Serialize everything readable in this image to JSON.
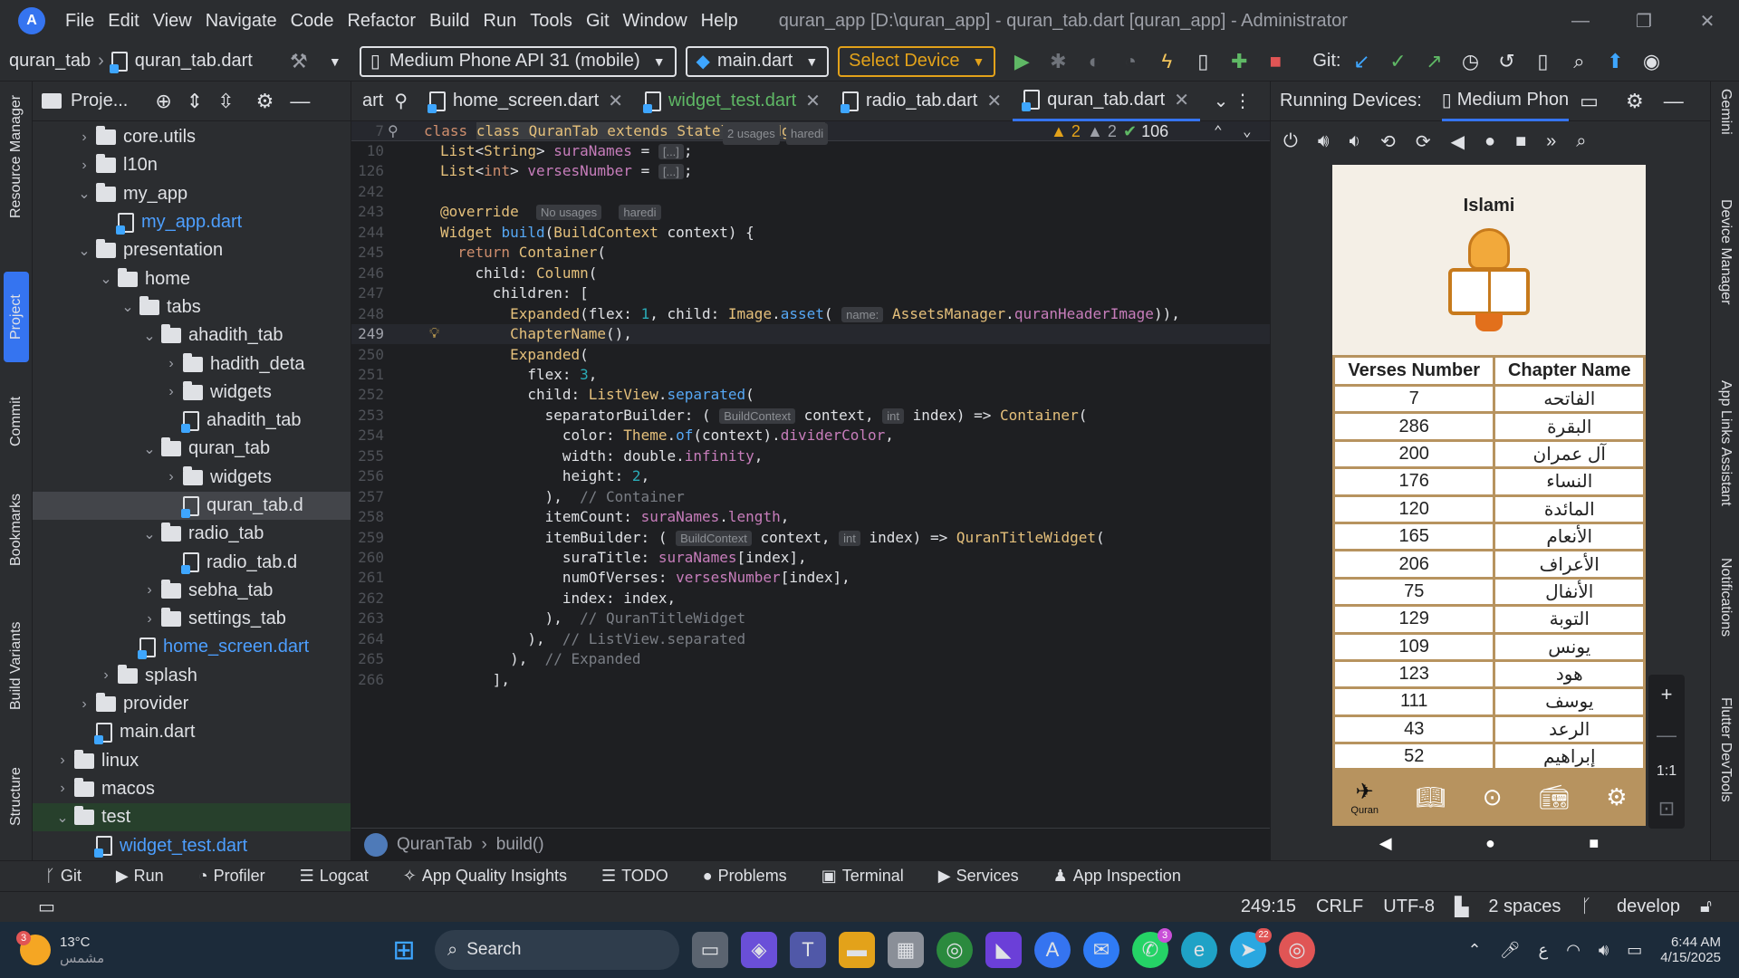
{
  "menubar": {
    "items": [
      "File",
      "Edit",
      "View",
      "Navigate",
      "Code",
      "Refactor",
      "Build",
      "Run",
      "Tools",
      "Git",
      "Window",
      "Help"
    ],
    "window_title": "quran_app [D:\\quran_app] - quran_tab.dart [quran_app] - Administrator"
  },
  "toolbar": {
    "crumb_project": "quran_tab",
    "crumb_file": "quran_tab.dart",
    "device_selector": "Medium Phone API 31 (mobile)",
    "run_config": "main.dart",
    "select_device": "Select Device",
    "git_label": "Git:"
  },
  "left_strip": [
    "Resource Manager",
    "Project",
    "Commit",
    "Bookmarks",
    "Build Variants",
    "Structure"
  ],
  "right_strip": [
    "Gemini",
    "Device Manager",
    "App Links Assistant",
    "Notifications",
    "Flutter DevTools"
  ],
  "project": {
    "title": "Proje...",
    "tree": [
      {
        "label": "core.utils",
        "depth": 1,
        "type": "folder",
        "chev": "›"
      },
      {
        "label": "l10n",
        "depth": 1,
        "type": "folder",
        "chev": "›"
      },
      {
        "label": "my_app",
        "depth": 1,
        "type": "folder",
        "chev": "⌄"
      },
      {
        "label": "my_app.dart",
        "depth": 2,
        "type": "dart",
        "blue": true
      },
      {
        "label": "presentation",
        "depth": 1,
        "type": "folder",
        "chev": "⌄"
      },
      {
        "label": "home",
        "depth": 2,
        "type": "folder",
        "chev": "⌄"
      },
      {
        "label": "tabs",
        "depth": 3,
        "type": "folder",
        "chev": "⌄"
      },
      {
        "label": "ahadith_tab",
        "depth": 4,
        "type": "folder",
        "chev": "⌄"
      },
      {
        "label": "hadith_deta",
        "depth": 5,
        "type": "folder",
        "chev": "›"
      },
      {
        "label": "widgets",
        "depth": 5,
        "type": "folder",
        "chev": "›"
      },
      {
        "label": "ahadith_tab",
        "depth": 5,
        "type": "dart"
      },
      {
        "label": "quran_tab",
        "depth": 4,
        "type": "folder",
        "chev": "⌄"
      },
      {
        "label": "widgets",
        "depth": 5,
        "type": "folder",
        "chev": "›"
      },
      {
        "label": "quran_tab.d",
        "depth": 5,
        "type": "dart",
        "selected": true
      },
      {
        "label": "radio_tab",
        "depth": 4,
        "type": "folder",
        "chev": "⌄"
      },
      {
        "label": "radio_tab.d",
        "depth": 5,
        "type": "dart"
      },
      {
        "label": "sebha_tab",
        "depth": 4,
        "type": "folder",
        "chev": "›"
      },
      {
        "label": "settings_tab",
        "depth": 4,
        "type": "folder",
        "chev": "›"
      },
      {
        "label": "home_screen.dart",
        "depth": 3,
        "type": "dart",
        "blue": true
      },
      {
        "label": "splash",
        "depth": 2,
        "type": "folder",
        "chev": "›"
      },
      {
        "label": "provider",
        "depth": 1,
        "type": "folder",
        "chev": "›"
      },
      {
        "label": "main.dart",
        "depth": 1,
        "type": "dart"
      },
      {
        "label": "linux",
        "depth": 0,
        "type": "folder",
        "chev": "›"
      },
      {
        "label": "macos",
        "depth": 0,
        "type": "folder",
        "chev": "›"
      },
      {
        "label": "test",
        "depth": 0,
        "type": "folder",
        "chev": "⌄",
        "test": true
      },
      {
        "label": "widget_test.dart",
        "depth": 1,
        "type": "dart",
        "blue": true
      }
    ]
  },
  "editor": {
    "tabs": [
      {
        "label": "art",
        "cur": false,
        "close": false
      },
      {
        "label": "home_screen.dart",
        "cur": false,
        "close": true
      },
      {
        "label": "widget_test.dart",
        "cur": false,
        "close": true,
        "green": true
      },
      {
        "label": "radio_tab.dart",
        "cur": false,
        "close": true
      },
      {
        "label": "quran_tab.dart",
        "cur": true,
        "close": true
      }
    ],
    "sticky": "class QuranTab extends StatelessWidget {",
    "sticky_hint": "2 usages",
    "sticky_author": "haredi",
    "inspections": {
      "warn1": "2",
      "warn2": "2",
      "ok": "106"
    },
    "breadcrumb_class": "QuranTab",
    "breadcrumb_method": "build()"
  },
  "code_lines": [
    {
      "n": "10",
      "html": "<span class='t'>List</span>&lt;<span class='t'>String</span>&gt; <span class='p'>suraNames</span> = <span class='hint'>[...]</span>;"
    },
    {
      "n": "126",
      "html": "<span class='t'>List</span>&lt;<span class='k'>int</span>&gt; <span class='p'>versesNumber</span> = <span class='hint'>[...]</span>;"
    },
    {
      "n": "242",
      "html": ""
    },
    {
      "n": "243",
      "html": "<span class='t'>@override</span>  <span class='hint'>No usages</span>  <span class='hint'>haredi</span>"
    },
    {
      "n": "244",
      "html": "<span class='t'>Widget</span> <span class='f'>build</span>(<span class='t'>BuildContext</span> context) {"
    },
    {
      "n": "245",
      "html": "  <span class='k'>return</span> <span class='t'>Container</span>("
    },
    {
      "n": "246",
      "html": "    child: <span class='t'>Column</span>("
    },
    {
      "n": "247",
      "html": "      children: ["
    },
    {
      "n": "248",
      "html": "        <span class='t'>Expanded</span>(flex: <span class='n'>1</span>, child: <span class='t'>Image</span>.<span class='f'>asset</span>( <span class='hint'>name:</span> <span class='t'>AssetsManager</span>.<span class='p'>quranHeaderImage</span>)),"
    },
    {
      "n": "249",
      "html": "        <span class='t'>ChapterName</span>(),",
      "cur": true
    },
    {
      "n": "250",
      "html": "        <span class='t'>Expanded</span>("
    },
    {
      "n": "251",
      "html": "          flex: <span class='n'>3</span>,"
    },
    {
      "n": "252",
      "html": "          child: <span class='t'>ListView</span>.<span class='f'>separated</span>("
    },
    {
      "n": "253",
      "html": "            separatorBuilder: ( <span class='hint'>BuildContext</span> context, <span class='hint'>int</span> index) =&gt; <span class='t'>Container</span>("
    },
    {
      "n": "254",
      "html": "              color: <span class='t'>Theme</span>.<span class='f'>of</span>(context).<span class='p'>dividerColor</span>,"
    },
    {
      "n": "255",
      "html": "              width: double.<span class='p'>infinity</span>,"
    },
    {
      "n": "256",
      "html": "              height: <span class='n'>2</span>,"
    },
    {
      "n": "257",
      "html": "            ),  <span class='c'>// Container</span>"
    },
    {
      "n": "258",
      "html": "            itemCount: <span class='p'>suraNames</span>.<span class='p'>length</span>,"
    },
    {
      "n": "259",
      "html": "            itemBuilder: ( <span class='hint'>BuildContext</span> context, <span class='hint'>int</span> index) =&gt; <span class='t'>QuranTitleWidget</span>("
    },
    {
      "n": "260",
      "html": "              suraTitle: <span class='p'>suraNames</span>[index],"
    },
    {
      "n": "261",
      "html": "              numOfVerses: <span class='p'>versesNumber</span>[index],"
    },
    {
      "n": "262",
      "html": "              index: index,"
    },
    {
      "n": "263",
      "html": "            ),  <span class='c'>// QuranTitleWidget</span>"
    },
    {
      "n": "264",
      "html": "          ),  <span class='c'>// ListView.separated</span>"
    },
    {
      "n": "265",
      "html": "        ),  <span class='c'>// Expanded</span>"
    },
    {
      "n": "266",
      "html": "      ],"
    }
  ],
  "device": {
    "title": "Running Devices:",
    "tab": "Medium Phon",
    "app_title": "Islami",
    "col_verses": "Verses Number",
    "col_chapter": "Chapter Name",
    "rows": [
      {
        "v": "7",
        "c": "الفاتحه"
      },
      {
        "v": "286",
        "c": "البقرة"
      },
      {
        "v": "200",
        "c": "آل عمران"
      },
      {
        "v": "176",
        "c": "النساء"
      },
      {
        "v": "120",
        "c": "المائدة"
      },
      {
        "v": "165",
        "c": "الأنعام"
      },
      {
        "v": "206",
        "c": "الأعراف"
      },
      {
        "v": "75",
        "c": "الأنفال"
      },
      {
        "v": "129",
        "c": "التوبة"
      },
      {
        "v": "109",
        "c": "يونس"
      },
      {
        "v": "123",
        "c": "هود"
      },
      {
        "v": "111",
        "c": "يوسف"
      },
      {
        "v": "43",
        "c": "الرعد"
      },
      {
        "v": "52",
        "c": "إبراهيم"
      }
    ],
    "nav_quran": "Quran",
    "zoom_ratio": "1:1"
  },
  "toolwindows": [
    "Git",
    "Run",
    "Profiler",
    "Logcat",
    "App Quality Insights",
    "TODO",
    "Problems",
    "Terminal",
    "Services",
    "App Inspection"
  ],
  "statusbar": {
    "pos": "249:15",
    "eol": "CRLF",
    "enc": "UTF-8",
    "indent": "2 spaces",
    "branch": "develop"
  },
  "taskbar": {
    "temp": "13°C",
    "weather": "مشمس",
    "search": "Search",
    "time": "6:44 AM",
    "date": "4/15/2025",
    "lang": "ع",
    "badge1": "3",
    "badge2": "3",
    "badge3": "22"
  },
  "colors": {
    "accent": "#3574f0",
    "gold": "#b7935f"
  }
}
